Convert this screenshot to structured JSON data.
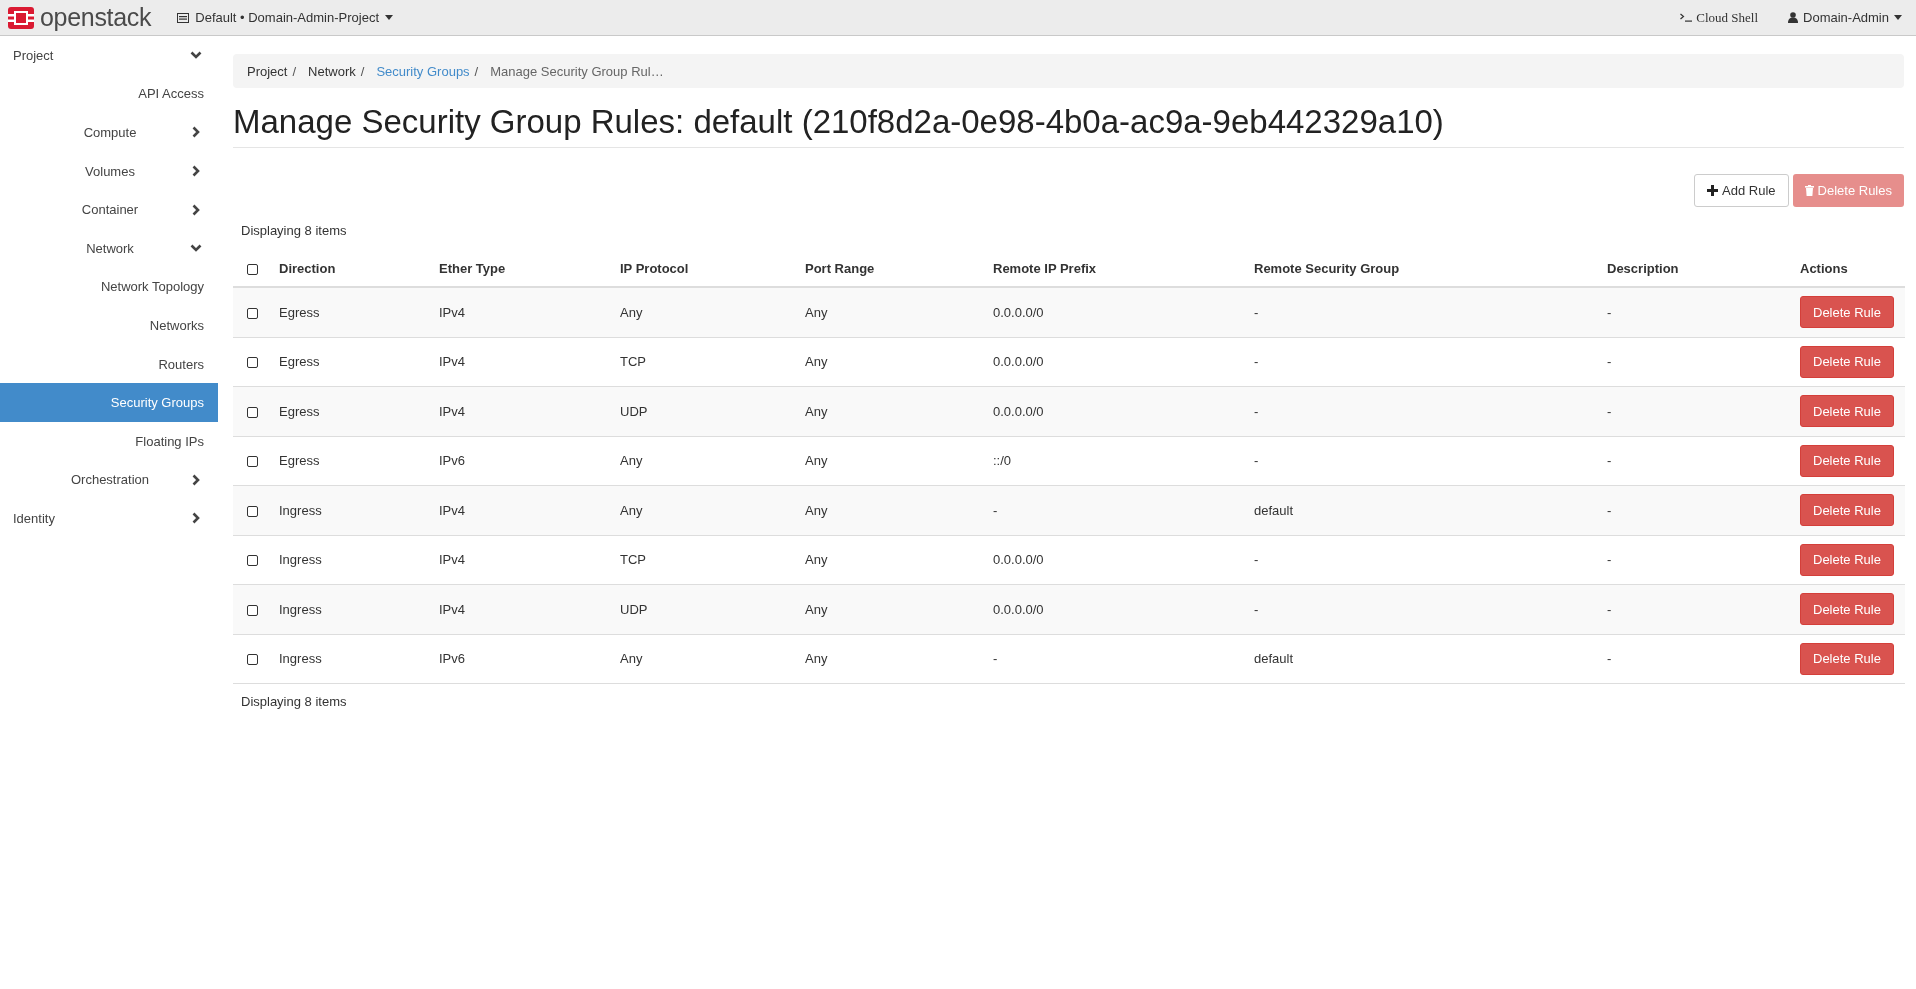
{
  "topbar": {
    "brand": "openstack",
    "project_selector": "Default • Domain-Admin-Project",
    "cloud_shell": "Cloud Shell",
    "user_menu": "Domain-Admin"
  },
  "sidebar": {
    "items": [
      {
        "label": "Project",
        "kind": "group",
        "expanded": true,
        "selected": false,
        "children": [
          {
            "label": "API Access",
            "kind": "item",
            "selected": false
          },
          {
            "label": "Compute",
            "kind": "group",
            "expanded": false,
            "selected": false
          },
          {
            "label": "Volumes",
            "kind": "group",
            "expanded": false,
            "selected": false
          },
          {
            "label": "Container",
            "kind": "group",
            "expanded": false,
            "selected": false
          },
          {
            "label": "Network",
            "kind": "group",
            "expanded": true,
            "selected": false,
            "children": [
              {
                "label": "Network Topology",
                "kind": "item",
                "selected": false
              },
              {
                "label": "Networks",
                "kind": "item",
                "selected": false
              },
              {
                "label": "Routers",
                "kind": "item",
                "selected": false
              },
              {
                "label": "Security Groups",
                "kind": "item",
                "selected": true
              },
              {
                "label": "Floating IPs",
                "kind": "item",
                "selected": false
              }
            ]
          },
          {
            "label": "Orchestration",
            "kind": "group",
            "expanded": false,
            "selected": false
          }
        ]
      },
      {
        "label": "Identity",
        "kind": "group",
        "expanded": false,
        "selected": false
      }
    ]
  },
  "breadcrumb_separator": "/",
  "breadcrumb": [
    {
      "label": "Project",
      "kind": "text"
    },
    {
      "label": "Network",
      "kind": "text"
    },
    {
      "label": "Security Groups",
      "kind": "link"
    },
    {
      "label": "Manage Security Group Rul…",
      "kind": "current"
    }
  ],
  "page_title": "Manage Security Group Rules: default (210f8d2a-0e98-4b0a-ac9a-9eb442329a10)",
  "actions": [
    {
      "label": "Add Rule",
      "kind": "add",
      "disabled": false
    },
    {
      "label": "Delete Rules",
      "kind": "delete",
      "disabled": true
    }
  ],
  "table": {
    "count_top": "Displaying 8 items",
    "count_bottom": "Displaying 8 items",
    "select_all_checked": false,
    "columns": [
      "Direction",
      "Ether Type",
      "IP Protocol",
      "Port Range",
      "Remote IP Prefix",
      "Remote Security Group",
      "Description",
      "Actions"
    ],
    "rows": [
      {
        "checked": false,
        "cells": [
          "Egress",
          "IPv4",
          "Any",
          "Any",
          "0.0.0.0/0",
          "-",
          "-"
        ],
        "action": "Delete Rule"
      },
      {
        "checked": false,
        "cells": [
          "Egress",
          "IPv4",
          "TCP",
          "Any",
          "0.0.0.0/0",
          "-",
          "-"
        ],
        "action": "Delete Rule"
      },
      {
        "checked": false,
        "cells": [
          "Egress",
          "IPv4",
          "UDP",
          "Any",
          "0.0.0.0/0",
          "-",
          "-"
        ],
        "action": "Delete Rule"
      },
      {
        "checked": false,
        "cells": [
          "Egress",
          "IPv6",
          "Any",
          "Any",
          "::/0",
          "-",
          "-"
        ],
        "action": "Delete Rule"
      },
      {
        "checked": false,
        "cells": [
          "Ingress",
          "IPv4",
          "Any",
          "Any",
          "-",
          "default",
          "-"
        ],
        "action": "Delete Rule"
      },
      {
        "checked": false,
        "cells": [
          "Ingress",
          "IPv4",
          "TCP",
          "Any",
          "0.0.0.0/0",
          "-",
          "-"
        ],
        "action": "Delete Rule"
      },
      {
        "checked": false,
        "cells": [
          "Ingress",
          "IPv4",
          "UDP",
          "Any",
          "0.0.0.0/0",
          "-",
          "-"
        ],
        "action": "Delete Rule"
      },
      {
        "checked": false,
        "cells": [
          "Ingress",
          "IPv6",
          "Any",
          "Any",
          "-",
          "default",
          "-"
        ],
        "action": "Delete Rule"
      }
    ]
  }
}
